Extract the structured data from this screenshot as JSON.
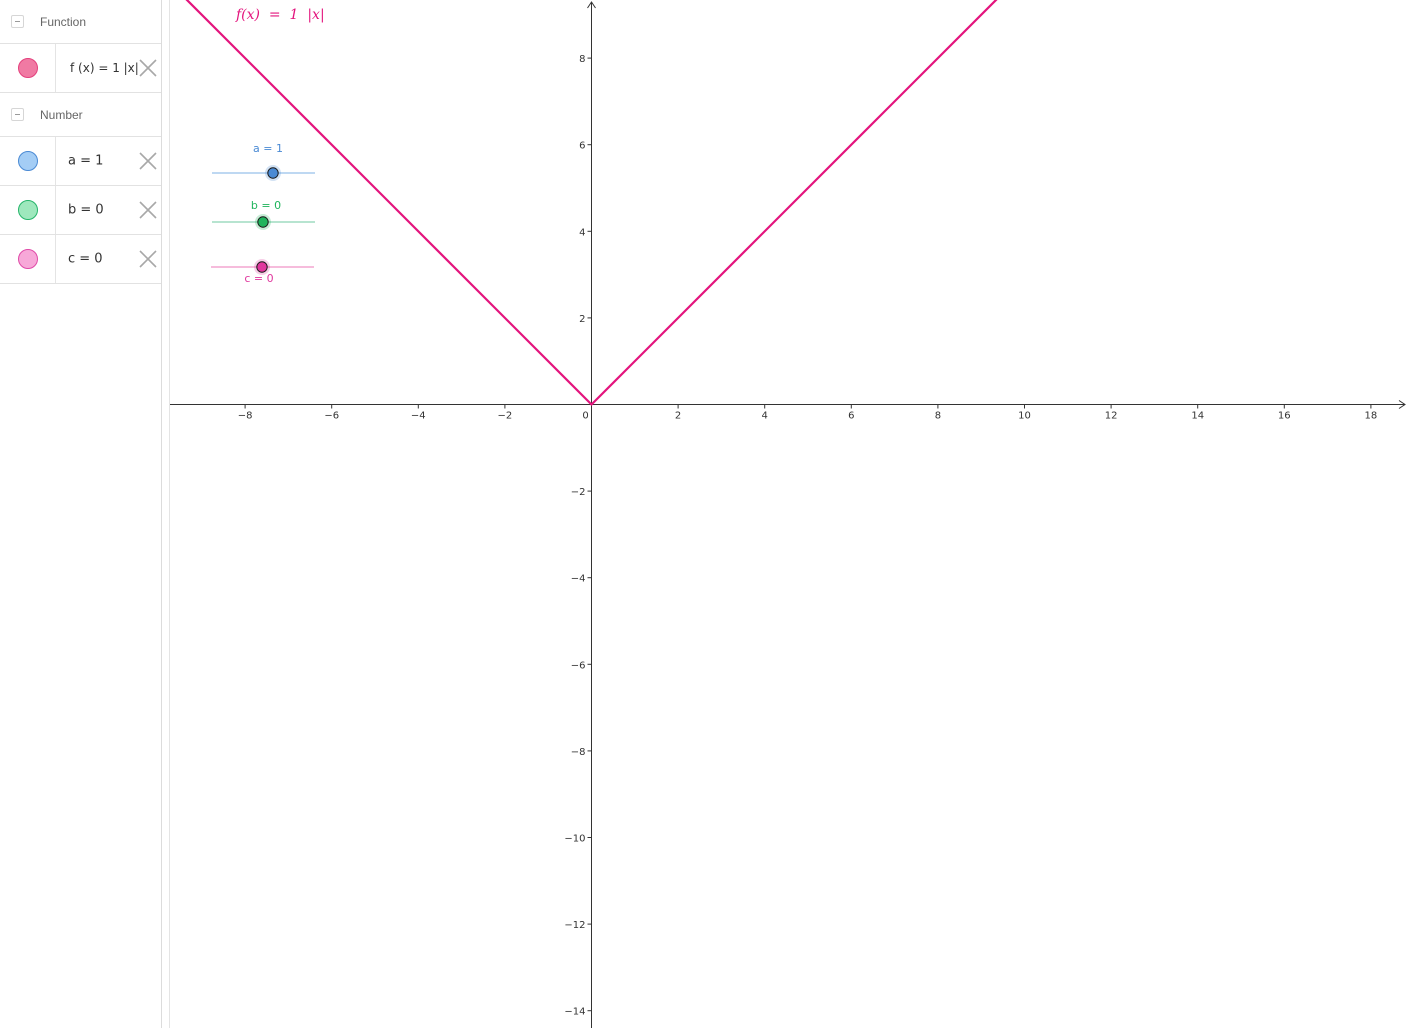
{
  "algebra": {
    "groups": [
      {
        "label": "Function",
        "items": [
          {
            "text": "f (x)  =  1  |x|",
            "color": "#e4407d",
            "fill": "#f07aa3"
          }
        ]
      },
      {
        "label": "Number",
        "items": [
          {
            "text": "a  =  1",
            "color": "#4a8ad4",
            "fill": "#a4cdf5"
          },
          {
            "text": "b  =  0",
            "color": "#25b56a",
            "fill": "#9ee8bd"
          },
          {
            "text": "c  =  0",
            "color": "#e04aa8",
            "fill": "#f7a8d8"
          }
        ]
      }
    ]
  },
  "graphics": {
    "function_caption": "f(x)  =  1  |x|",
    "function_color": "#e3147d",
    "x_ticks": [
      "−8",
      "−6",
      "−4",
      "−2",
      "0",
      "2",
      "4",
      "6",
      "8",
      "10",
      "12",
      "14",
      "16",
      "18"
    ],
    "y_ticks": [
      "8",
      "6",
      "4",
      "2",
      "−2",
      "−4",
      "−6",
      "−8",
      "−10",
      "−12",
      "−14"
    ],
    "sliders": [
      {
        "label": "a = 1",
        "color": "#4a8ad4",
        "line_color": "#a9cbee",
        "value": 1,
        "min": -5,
        "max": 5
      },
      {
        "label": "b = 0",
        "color": "#1fb45c",
        "line_color": "#9fdcc0",
        "value": 0,
        "min": -5,
        "max": 5
      },
      {
        "label": "c = 0",
        "color": "#e0379e",
        "line_color": "#f4a5d0",
        "value": 0,
        "min": -5,
        "max": 5
      }
    ]
  },
  "chart_data": {
    "type": "line",
    "series": [
      {
        "name": "f(x)  =  1  |x|",
        "x": [
          -9.7,
          0,
          9.5
        ],
        "y": [
          9.7,
          0,
          9.5
        ]
      }
    ],
    "xlim": [
      -9.8,
      18.8
    ],
    "ylim": [
      -14.2,
      9.3
    ],
    "grid": false
  }
}
